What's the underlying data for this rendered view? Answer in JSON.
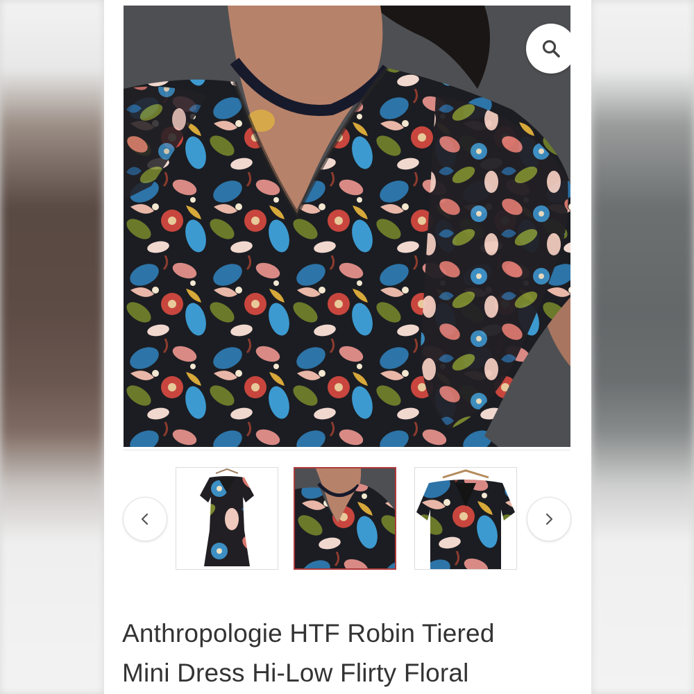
{
  "product": {
    "title_line1": "Anthropologie HTF Robin Tiered",
    "title_line2": "Mini Dress Hi-Low Flirty Floral"
  },
  "gallery": {
    "selected_index": 1,
    "thumbnail_count": 3,
    "icons": {
      "zoom": "magnifier-icon",
      "prev": "chevron-left-icon",
      "next": "chevron-right-icon"
    }
  },
  "colors": {
    "panel_background": "#ffffff",
    "selected_thumb_border": "#b03a3a",
    "title_text": "#333333",
    "icon": "#444444"
  }
}
